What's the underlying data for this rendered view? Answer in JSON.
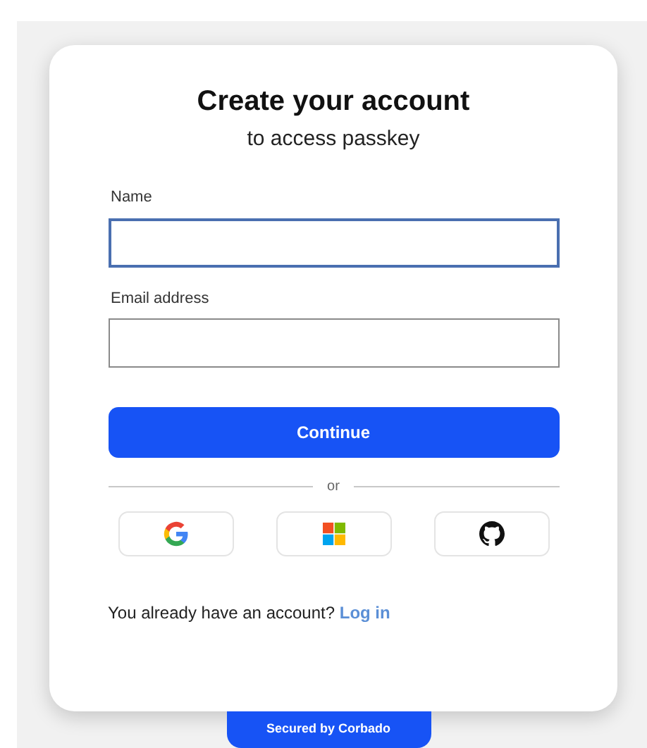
{
  "title": "Create your account",
  "subtitle": "to access passkey",
  "fields": [
    {
      "label": "Name",
      "focused": true
    },
    {
      "label": "Email address",
      "focused": false
    }
  ],
  "continue_button": "Continue",
  "divider": "or",
  "social_buttons": [
    {
      "kind": "google"
    },
    {
      "kind": "microsoft"
    },
    {
      "kind": "github"
    }
  ],
  "login_prompt": {
    "text": "You already have an account?",
    "link": "Log in"
  },
  "footer_badge": "Secured by Corbado"
}
